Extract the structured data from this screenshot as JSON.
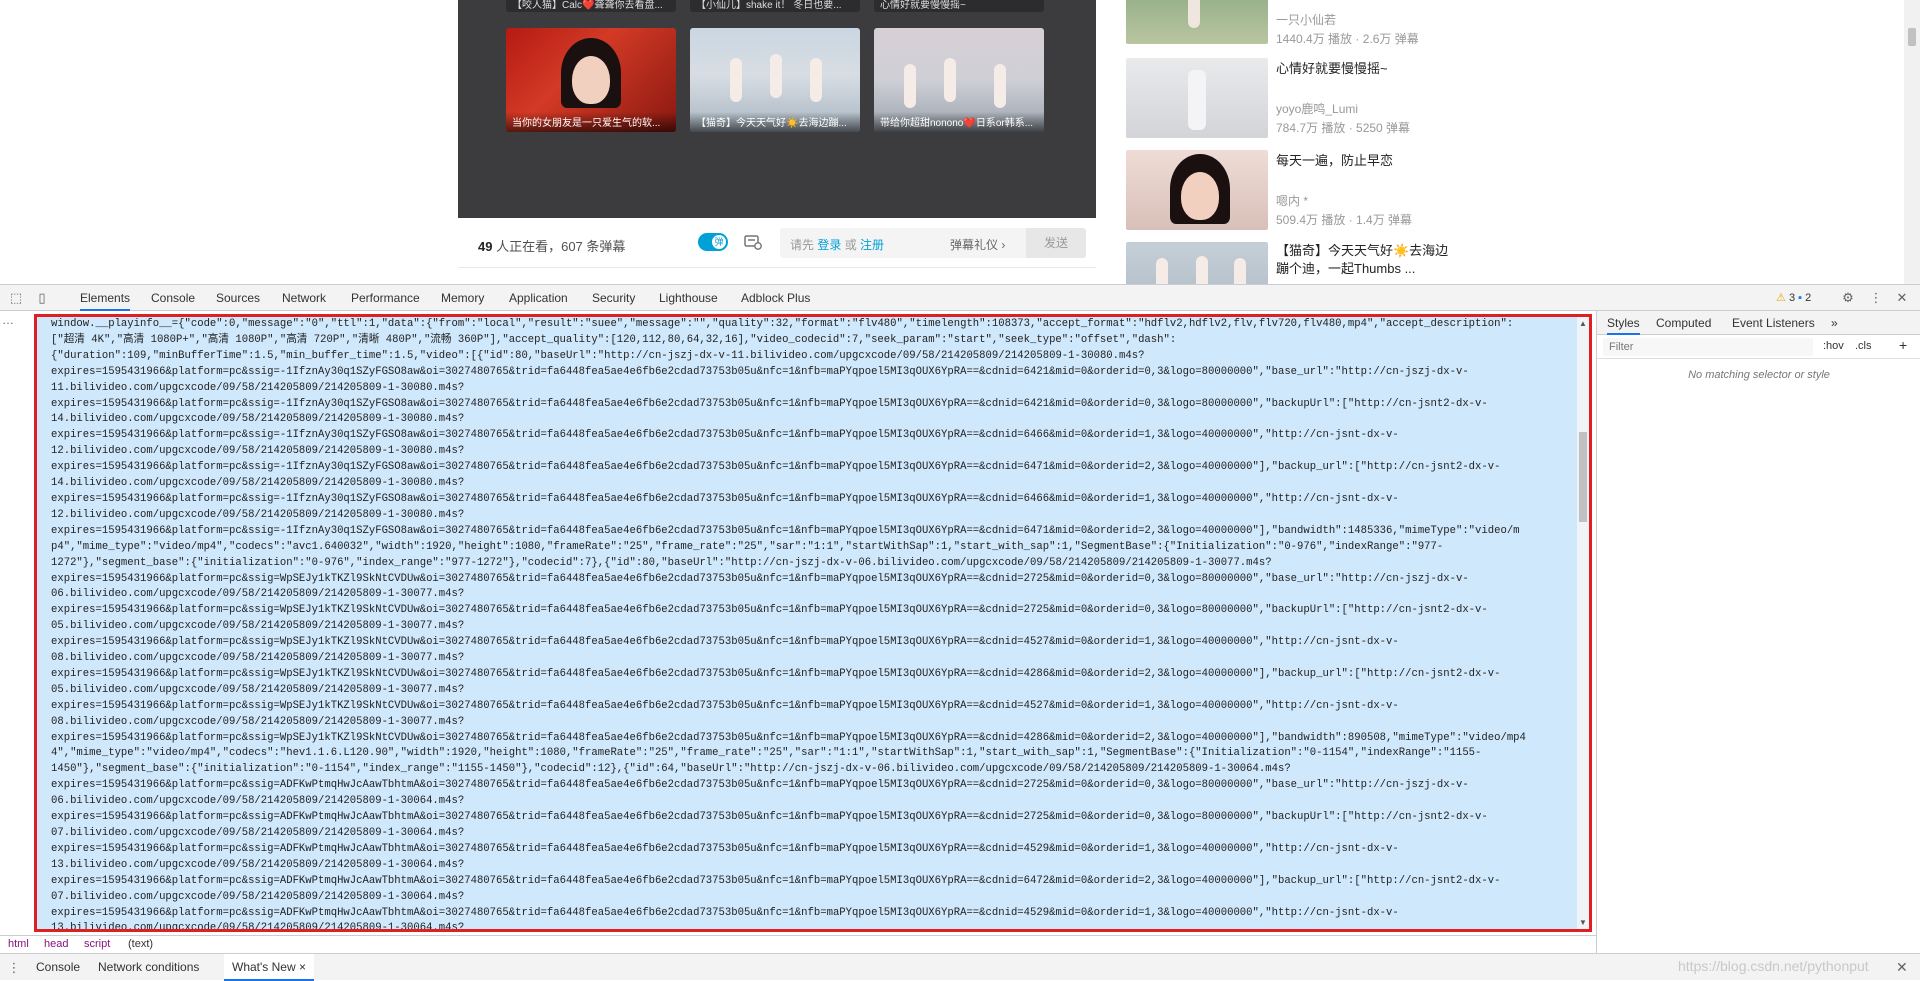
{
  "page": {
    "end_screen_top_captions": [
      "【咬人猫】Calc❤️聋聋你去看盘...",
      "【小仙儿】shake it！ 冬日也要...",
      "心情好就要慢慢摇~"
    ],
    "end_screen_cards": [
      {
        "caption": "当你的女朋友是一只爱生气的软..."
      },
      {
        "caption": "【猫奇】今天天气好☀️去海边蹦..."
      },
      {
        "caption": "带给你超甜nonono❤️日系or韩系..."
      }
    ],
    "danmaku_bar": {
      "viewer_count": "49",
      "viewer_suffix": " 人正在看，",
      "danmaku_count": "607 条弹幕",
      "toggle_label": "弹",
      "hint_prefix": "请先 ",
      "login": "登录",
      "or": " 或 ",
      "register": "注册",
      "etiquette": "弹幕礼仪 ›",
      "send": "发送"
    },
    "recommendations": [
      {
        "title": "",
        "up": "一只小仙若",
        "stats": "1440.4万 播放 · 2.6万 弹幕"
      },
      {
        "title": "心情好就要慢慢摇~",
        "up": "yoyo鹿鸣_Lumi",
        "stats": "784.7万 播放 · 5250 弹幕"
      },
      {
        "title": "每天一遍，防止早恋",
        "up": "嗯内 *",
        "stats": "509.4万 播放 · 1.4万 弹幕"
      },
      {
        "title": "【猫奇】今天天气好☀️去海边蹦个迪，一起Thumbs ...",
        "up": "",
        "stats": ""
      }
    ]
  },
  "devtools": {
    "tabs": [
      "Elements",
      "Console",
      "Sources",
      "Network",
      "Performance",
      "Memory",
      "Application",
      "Security",
      "Lighthouse",
      "Adblock Plus"
    ],
    "active_tab": "Elements",
    "warnings": "3",
    "messages": "2",
    "script_lines": [
      "window.__playinfo__={\"code\":0,\"message\":\"0\",\"ttl\":1,\"data\":{\"from\":\"local\",\"result\":\"suee\",\"message\":\"\",\"quality\":32,\"format\":\"flv480\",\"timelength\":108373,\"accept_format\":\"hdflv2,hdflv2,flv,flv720,flv480,mp4\",\"accept_description\":",
      "[\"超清 4K\",\"高清 1080P+\",\"高清 1080P\",\"高清 720P\",\"清晰 480P\",\"流畅 360P\"],\"accept_quality\":[120,112,80,64,32,16],\"video_codecid\":7,\"seek_param\":\"start\",\"seek_type\":\"offset\",\"dash\":",
      "{\"duration\":109,\"minBufferTime\":1.5,\"min_buffer_time\":1.5,\"video\":[{\"id\":80,\"baseUrl\":\"http://cn-jszj-dx-v-11.bilivideo.com/upgcxcode/09/58/214205809/214205809-1-30080.m4s?",
      "expires=1595431966&platform=pc&ssig=-1IfznAy30q1SZyFGSO8aw&oi=3027480765&trid=fa6448fea5ae4e6fb6e2cdad73753b05u&nfc=1&nfb=maPYqpoel5MI3qOUX6YpRA==&cdnid=6421&mid=0&orderid=0,3&logo=80000000\",\"base_url\":\"http://cn-jszj-dx-v-",
      "11.bilivideo.com/upgcxcode/09/58/214205809/214205809-1-30080.m4s?",
      "expires=1595431966&platform=pc&ssig=-1IfznAy30q1SZyFGSO8aw&oi=3027480765&trid=fa6448fea5ae4e6fb6e2cdad73753b05u&nfc=1&nfb=maPYqpoel5MI3qOUX6YpRA==&cdnid=6421&mid=0&orderid=0,3&logo=80000000\",\"backupUrl\":[\"http://cn-jsnt2-dx-v-",
      "14.bilivideo.com/upgcxcode/09/58/214205809/214205809-1-30080.m4s?",
      "expires=1595431966&platform=pc&ssig=-1IfznAy30q1SZyFGSO8aw&oi=3027480765&trid=fa6448fea5ae4e6fb6e2cdad73753b05u&nfc=1&nfb=maPYqpoel5MI3qOUX6YpRA==&cdnid=6466&mid=0&orderid=1,3&logo=40000000\",\"http://cn-jsnt-dx-v-",
      "12.bilivideo.com/upgcxcode/09/58/214205809/214205809-1-30080.m4s?",
      "expires=1595431966&platform=pc&ssig=-1IfznAy30q1SZyFGSO8aw&oi=3027480765&trid=fa6448fea5ae4e6fb6e2cdad73753b05u&nfc=1&nfb=maPYqpoel5MI3qOUX6YpRA==&cdnid=6471&mid=0&orderid=2,3&logo=40000000\"],\"backup_url\":[\"http://cn-jsnt2-dx-v-",
      "14.bilivideo.com/upgcxcode/09/58/214205809/214205809-1-30080.m4s?",
      "expires=1595431966&platform=pc&ssig=-1IfznAy30q1SZyFGSO8aw&oi=3027480765&trid=fa6448fea5ae4e6fb6e2cdad73753b05u&nfc=1&nfb=maPYqpoel5MI3qOUX6YpRA==&cdnid=6466&mid=0&orderid=1,3&logo=40000000\",\"http://cn-jsnt-dx-v-",
      "12.bilivideo.com/upgcxcode/09/58/214205809/214205809-1-30080.m4s?",
      "expires=1595431966&platform=pc&ssig=-1IfznAy30q1SZyFGSO8aw&oi=3027480765&trid=fa6448fea5ae4e6fb6e2cdad73753b05u&nfc=1&nfb=maPYqpoel5MI3qOUX6YpRA==&cdnid=6471&mid=0&orderid=2,3&logo=40000000\"],\"bandwidth\":1485336,\"mimeType\":\"video/m",
      "p4\",\"mime_type\":\"video/mp4\",\"codecs\":\"avc1.640032\",\"width\":1920,\"height\":1080,\"frameRate\":\"25\",\"frame_rate\":\"25\",\"sar\":\"1:1\",\"startWithSap\":1,\"start_with_sap\":1,\"SegmentBase\":{\"Initialization\":\"0-976\",\"indexRange\":\"977-",
      "1272\"},\"segment_base\":{\"initialization\":\"0-976\",\"index_range\":\"977-1272\"},\"codecid\":7},{\"id\":80,\"baseUrl\":\"http://cn-jszj-dx-v-06.bilivideo.com/upgcxcode/09/58/214205809/214205809-1-30077.m4s?",
      "expires=1595431966&platform=pc&ssig=WpSEJy1kTKZl9SkNtCVDUw&oi=3027480765&trid=fa6448fea5ae4e6fb6e2cdad73753b05u&nfc=1&nfb=maPYqpoel5MI3qOUX6YpRA==&cdnid=2725&mid=0&orderid=0,3&logo=80000000\",\"base_url\":\"http://cn-jszj-dx-v-",
      "06.bilivideo.com/upgcxcode/09/58/214205809/214205809-1-30077.m4s?",
      "expires=1595431966&platform=pc&ssig=WpSEJy1kTKZl9SkNtCVDUw&oi=3027480765&trid=fa6448fea5ae4e6fb6e2cdad73753b05u&nfc=1&nfb=maPYqpoel5MI3qOUX6YpRA==&cdnid=2725&mid=0&orderid=0,3&logo=80000000\",\"backupUrl\":[\"http://cn-jsnt2-dx-v-",
      "05.bilivideo.com/upgcxcode/09/58/214205809/214205809-1-30077.m4s?",
      "expires=1595431966&platform=pc&ssig=WpSEJy1kTKZl9SkNtCVDUw&oi=3027480765&trid=fa6448fea5ae4e6fb6e2cdad73753b05u&nfc=1&nfb=maPYqpoel5MI3qOUX6YpRA==&cdnid=4527&mid=0&orderid=1,3&logo=40000000\",\"http://cn-jsnt-dx-v-",
      "08.bilivideo.com/upgcxcode/09/58/214205809/214205809-1-30077.m4s?",
      "expires=1595431966&platform=pc&ssig=WpSEJy1kTKZl9SkNtCVDUw&oi=3027480765&trid=fa6448fea5ae4e6fb6e2cdad73753b05u&nfc=1&nfb=maPYqpoel5MI3qOUX6YpRA==&cdnid=4286&mid=0&orderid=2,3&logo=40000000\"],\"backup_url\":[\"http://cn-jsnt2-dx-v-",
      "05.bilivideo.com/upgcxcode/09/58/214205809/214205809-1-30077.m4s?",
      "expires=1595431966&platform=pc&ssig=WpSEJy1kTKZl9SkNtCVDUw&oi=3027480765&trid=fa6448fea5ae4e6fb6e2cdad73753b05u&nfc=1&nfb=maPYqpoel5MI3qOUX6YpRA==&cdnid=4527&mid=0&orderid=1,3&logo=40000000\",\"http://cn-jsnt-dx-v-",
      "08.bilivideo.com/upgcxcode/09/58/214205809/214205809-1-30077.m4s?",
      "expires=1595431966&platform=pc&ssig=WpSEJy1kTKZl9SkNtCVDUw&oi=3027480765&trid=fa6448fea5ae4e6fb6e2cdad73753b05u&nfc=1&nfb=maPYqpoel5MI3qOUX6YpRA==&cdnid=4286&mid=0&orderid=2,3&logo=40000000\"],\"bandwidth\":890508,\"mimeType\":\"video/mp4",
      "4\",\"mime_type\":\"video/mp4\",\"codecs\":\"hev1.1.6.L120.90\",\"width\":1920,\"height\":1080,\"frameRate\":\"25\",\"frame_rate\":\"25\",\"sar\":\"1:1\",\"startWithSap\":1,\"start_with_sap\":1,\"SegmentBase\":{\"Initialization\":\"0-1154\",\"indexRange\":\"1155-",
      "1450\"},\"segment_base\":{\"initialization\":\"0-1154\",\"index_range\":\"1155-1450\"},\"codecid\":12},{\"id\":64,\"baseUrl\":\"http://cn-jszj-dx-v-06.bilivideo.com/upgcxcode/09/58/214205809/214205809-1-30064.m4s?",
      "expires=1595431966&platform=pc&ssig=ADFKwPtmqHwJcAawTbhtmA&oi=3027480765&trid=fa6448fea5ae4e6fb6e2cdad73753b05u&nfc=1&nfb=maPYqpoel5MI3qOUX6YpRA==&cdnid=2725&mid=0&orderid=0,3&logo=80000000\",\"base_url\":\"http://cn-jszj-dx-v-",
      "06.bilivideo.com/upgcxcode/09/58/214205809/214205809-1-30064.m4s?",
      "expires=1595431966&platform=pc&ssig=ADFKwPtmqHwJcAawTbhtmA&oi=3027480765&trid=fa6448fea5ae4e6fb6e2cdad73753b05u&nfc=1&nfb=maPYqpoel5MI3qOUX6YpRA==&cdnid=2725&mid=0&orderid=0,3&logo=80000000\",\"backupUrl\":[\"http://cn-jsnt2-dx-v-",
      "07.bilivideo.com/upgcxcode/09/58/214205809/214205809-1-30064.m4s?",
      "expires=1595431966&platform=pc&ssig=ADFKwPtmqHwJcAawTbhtmA&oi=3027480765&trid=fa6448fea5ae4e6fb6e2cdad73753b05u&nfc=1&nfb=maPYqpoel5MI3qOUX6YpRA==&cdnid=4529&mid=0&orderid=1,3&logo=40000000\",\"http://cn-jsnt-dx-v-",
      "13.bilivideo.com/upgcxcode/09/58/214205809/214205809-1-30064.m4s?",
      "expires=1595431966&platform=pc&ssig=ADFKwPtmqHwJcAawTbhtmA&oi=3027480765&trid=fa6448fea5ae4e6fb6e2cdad73753b05u&nfc=1&nfb=maPYqpoel5MI3qOUX6YpRA==&cdnid=6472&mid=0&orderid=2,3&logo=40000000\"],\"backup_url\":[\"http://cn-jsnt2-dx-v-",
      "07.bilivideo.com/upgcxcode/09/58/214205809/214205809-1-30064.m4s?",
      "expires=1595431966&platform=pc&ssig=ADFKwPtmqHwJcAawTbhtmA&oi=3027480765&trid=fa6448fea5ae4e6fb6e2cdad73753b05u&nfc=1&nfb=maPYqpoel5MI3qOUX6YpRA==&cdnid=4529&mid=0&orderid=1,3&logo=40000000\",\"http://cn-jsnt-dx-v-",
      "13.bilivideo.com/upgcxcode/09/58/214205809/214205809-1-30064.m4s?"
    ],
    "breadcrumb": [
      "html",
      "head",
      "script",
      "(text)"
    ],
    "styles_pane": {
      "tabs": [
        "Styles",
        "Computed",
        "Event Listeners",
        "»"
      ],
      "active_tab": "Styles",
      "filter_placeholder": "Filter",
      "hov": ":hov",
      "cls": ".cls",
      "plus": "+",
      "empty_message": "No matching selector or style"
    },
    "drawer": {
      "tabs": [
        "Console",
        "Network conditions",
        "What's New"
      ],
      "active_tab": "What's New",
      "close_glyph": "×"
    },
    "watermark": "https://blog.csdn.net/pythonput"
  },
  "colors": {
    "selection_bg": "#cfe8fc",
    "highlight_border": "#e02020",
    "bilibili_blue": "#00a1d6",
    "devtools_blue": "#1a73e8"
  }
}
